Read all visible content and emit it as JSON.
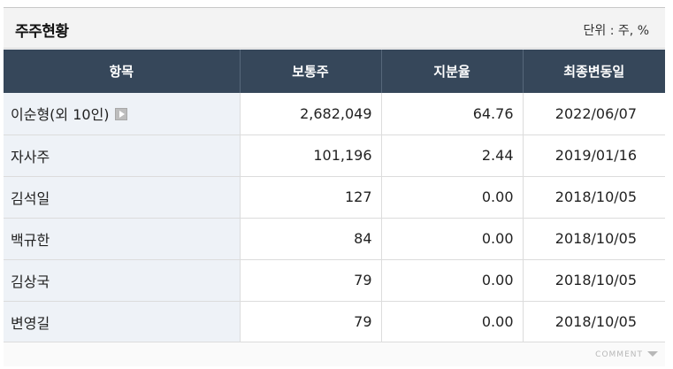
{
  "panel": {
    "title": "주주현황",
    "unit": "단위 : 주, %"
  },
  "table": {
    "headers": [
      "항목",
      "보통주",
      "지분율",
      "최종변동일"
    ],
    "rows": [
      {
        "name": "이순형(외 10인)",
        "shares": "2,682,049",
        "ratio": "64.76",
        "date": "2022/06/07",
        "has_more": true
      },
      {
        "name": "자사주",
        "shares": "101,196",
        "ratio": "2.44",
        "date": "2019/01/16"
      },
      {
        "name": "김석일",
        "shares": "127",
        "ratio": "0.00",
        "date": "2018/10/05"
      },
      {
        "name": "백규한",
        "shares": "84",
        "ratio": "0.00",
        "date": "2018/10/05"
      },
      {
        "name": "김상국",
        "shares": "79",
        "ratio": "0.00",
        "date": "2018/10/05"
      },
      {
        "name": "변영길",
        "shares": "79",
        "ratio": "0.00",
        "date": "2018/10/05"
      }
    ]
  },
  "footer": {
    "comment_label": "COMMENT"
  },
  "icons": {
    "more": "play-arrow-icon",
    "comment_toggle": "caret-down-icon"
  },
  "colors": {
    "header_bg": "#36475a",
    "name_col_bg": "#eef2f7"
  }
}
